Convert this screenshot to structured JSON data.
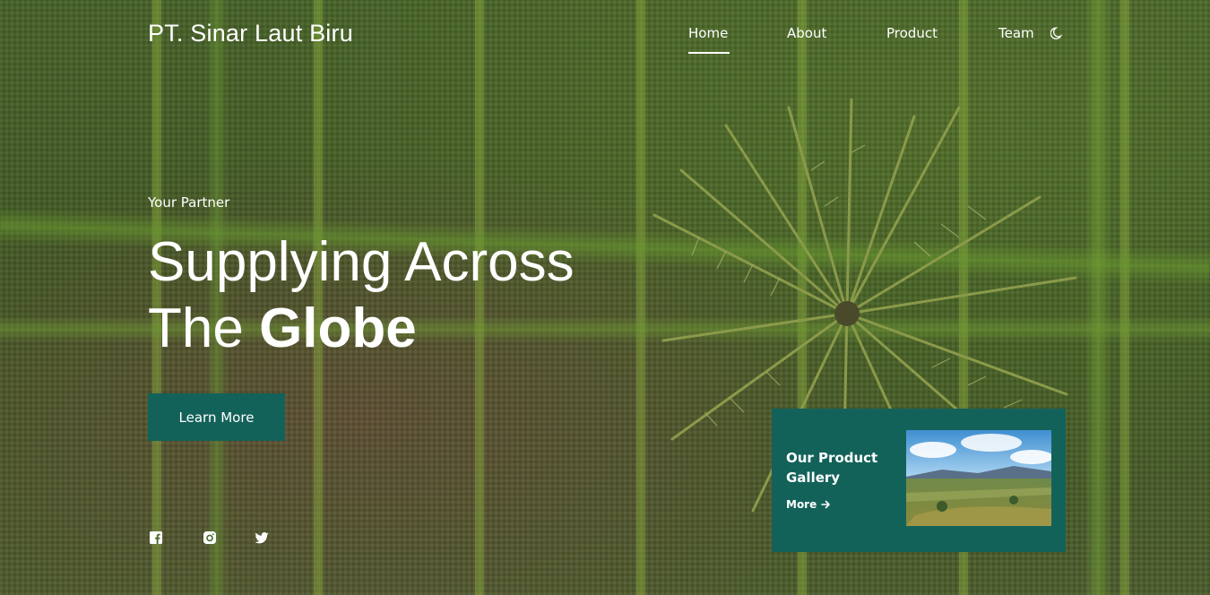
{
  "brand": {
    "name": "PT. Sinar Laut Biru"
  },
  "nav": {
    "items": [
      {
        "label": "Home",
        "active": true
      },
      {
        "label": "About"
      },
      {
        "label": "Product"
      },
      {
        "label": "Team"
      }
    ],
    "theme_toggle_icon": "moon-icon"
  },
  "hero": {
    "tagline": "Your Partner",
    "headline_line1": "Supplying Across",
    "headline_line2_prefix": "The ",
    "headline_line2_bold": "Globe",
    "cta_label": "Learn More"
  },
  "social": [
    "facebook-icon",
    "instagram-icon",
    "twitter-icon"
  ],
  "gallery_card": {
    "title": "Our Product Gallery",
    "more_label": "More",
    "more_icon": "arrow-right-icon"
  },
  "colors": {
    "accent": "#13625a",
    "text": "#ffffff"
  }
}
